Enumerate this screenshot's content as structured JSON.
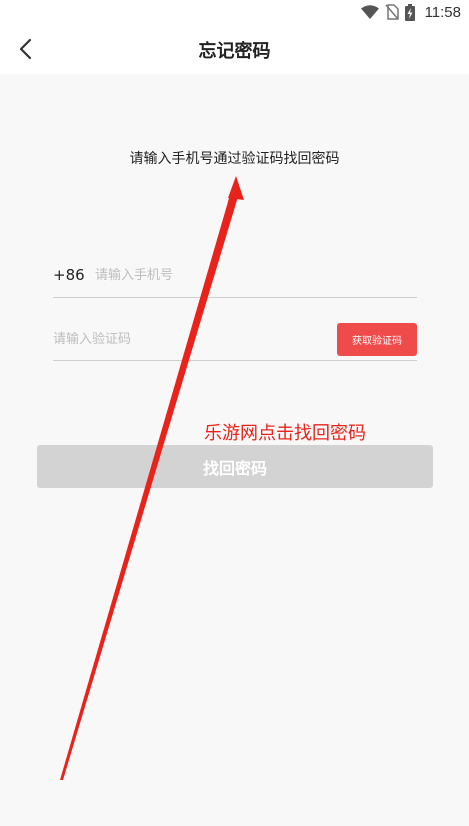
{
  "status_bar": {
    "time": "11:58",
    "icons": [
      "wifi-icon",
      "no-sim-icon",
      "battery-charging-icon"
    ]
  },
  "nav": {
    "back_icon": "chevron-left-icon",
    "title": "忘记密码"
  },
  "hint": "请输入手机号通过验证码找回密码",
  "form": {
    "country_code": "+86",
    "phone_placeholder": "请输入手机号",
    "code_placeholder": "请输入验证码",
    "get_code_label": "获取验证码",
    "submit_label": "找回密码"
  },
  "annotation": {
    "text": "乐游网点击找回密码",
    "color": "#e8231b"
  },
  "colors": {
    "accent_red": "#ef4b4b",
    "button_disabled": "#d3d3d3",
    "background": "#f8f8f8"
  }
}
